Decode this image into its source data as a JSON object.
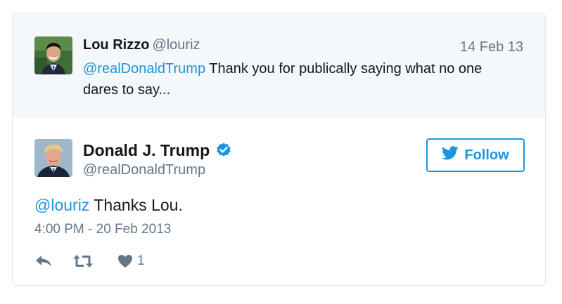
{
  "parent_tweet": {
    "author_name": "Lou Rizzo",
    "author_handle": "@louriz",
    "date": "14 Feb 13",
    "mention": "@realDonaldTrump",
    "text": " Thank you for publically saying what no one dares to say..."
  },
  "main_tweet": {
    "author_name": "Donald J. Trump",
    "author_handle": "@realDonaldTrump",
    "verified": true,
    "mention": "@louriz",
    "text": " Thanks Lou.",
    "timestamp": "4:00 PM - 20 Feb 2013",
    "like_count": "1"
  },
  "follow_button": {
    "label": "Follow",
    "icon": "twitter-bird-icon"
  },
  "colors": {
    "accent": "#1b95e0",
    "muted": "#657786",
    "text": "#14171a",
    "parent_bg": "#f5f8fa",
    "border": "#e1e8ed"
  },
  "icons": {
    "reply": "reply-icon",
    "retweet": "retweet-icon",
    "like": "heart-icon",
    "verified": "verified-badge-icon"
  }
}
